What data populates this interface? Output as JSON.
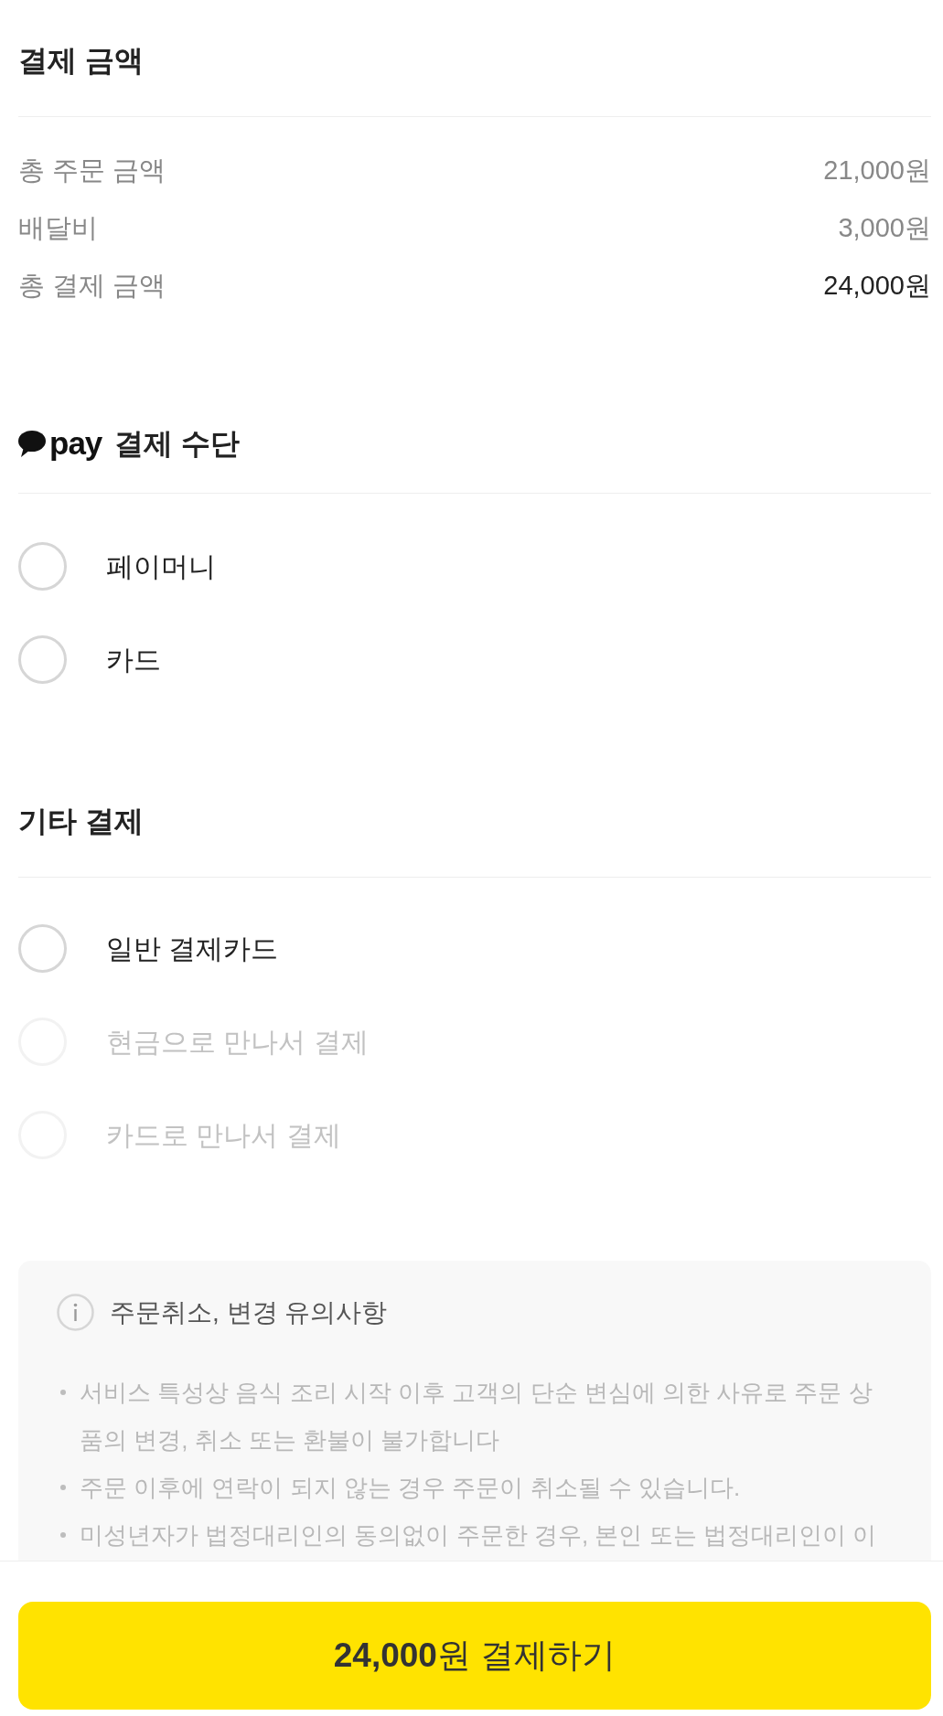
{
  "payment_summary": {
    "title": "결제 금액",
    "rows": [
      {
        "kind": "line",
        "label": "총 주문 금액",
        "value": "21,000원"
      },
      {
        "kind": "line",
        "label": "배달비",
        "value": "3,000원"
      },
      {
        "kind": "total",
        "label": "총 결제 금액",
        "value": "24,000원"
      }
    ]
  },
  "kakao_pay": {
    "logo_text": "pay",
    "title": "결제 수단",
    "options": [
      {
        "label": "페이머니",
        "selected": false
      },
      {
        "label": "카드",
        "selected": false
      }
    ]
  },
  "other_payment": {
    "title": "기타 결제",
    "options": [
      {
        "label": "일반 결제카드",
        "selected": false,
        "disabled": false
      },
      {
        "label": "현금으로 만나서 결제",
        "selected": false,
        "disabled": true
      },
      {
        "label": "카드로 만나서 결제",
        "selected": false,
        "disabled": true
      }
    ]
  },
  "notice": {
    "title": "주문취소, 변경 유의사항",
    "items": [
      "서비스 특성상 음식 조리 시작 이후 고객의 단순 변심에 의한 사유로 주문 상품의 변경, 취소 또는 환불이 불가합니다",
      "주문 이후에 연락이 되지 않는 경우 주문이 취소될 수 있습니다.",
      "미성년자가 법정대리인의 동의없이 주문한 경우, 본인 또는 법정대리인이 이"
    ]
  },
  "pay_button": {
    "label": "**24,000**원 결제하기"
  }
}
